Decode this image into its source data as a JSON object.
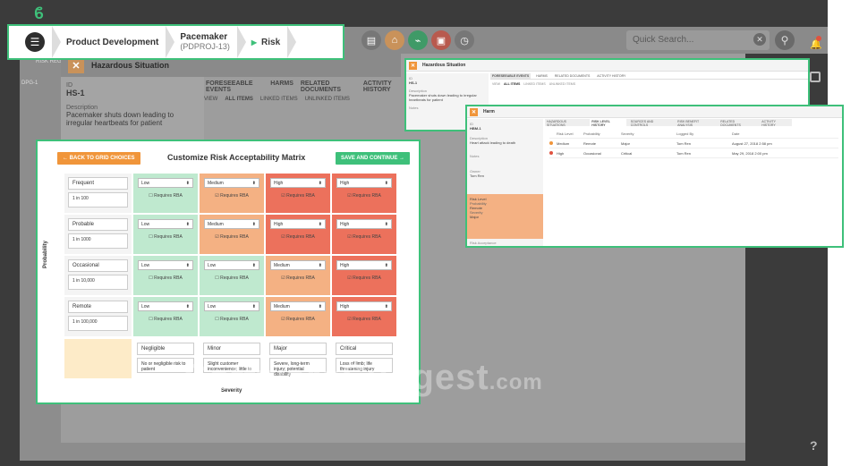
{
  "breadcrumb": {
    "items": [
      {
        "label": "Product Development",
        "sub": ""
      },
      {
        "label": "Pacemaker",
        "sub": "(PDPROJ-13)"
      },
      {
        "label": "Risk",
        "sub": ""
      }
    ]
  },
  "toolbar": {
    "search_placeholder": "Quick Search..."
  },
  "hazard_panel": {
    "title": "Hazardous Situation",
    "id_label": "ID",
    "id_value": "HS-1",
    "description_label": "Description",
    "description_value": "Pacemaker shuts down leading to irregular heartbeats for patient",
    "tabs": [
      "FORESEEABLE EVENTS",
      "HARMS",
      "RELATED DOCUMENTS",
      "ACTIVITY HISTORY"
    ],
    "subtabs": [
      "VIEW",
      "ALL ITEMS",
      "LINKED ITEMS",
      "UNLINKED ITEMS"
    ]
  },
  "matrix": {
    "back_label": "← BACK TO GRID CHOICES",
    "title": "Customize Risk Acceptability Matrix",
    "save_label": "SAVE AND CONTINUE →",
    "axis_y": "Probability",
    "axis_x": "Severity",
    "rows": [
      {
        "name": "Frequent",
        "desc": "1 in 100",
        "cells": [
          [
            "Low",
            "Requires RBA",
            "low"
          ],
          [
            "Medium",
            "Requires RBA",
            "med"
          ],
          [
            "High",
            "Requires RBA",
            "high"
          ],
          [
            "High",
            "Requires RBA",
            "high"
          ]
        ]
      },
      {
        "name": "Probable",
        "desc": "1 in 1000",
        "cells": [
          [
            "Low",
            "Requires RBA",
            "low"
          ],
          [
            "Medium",
            "Requires RBA",
            "med"
          ],
          [
            "High",
            "Requires RBA",
            "high"
          ],
          [
            "High",
            "Requires RBA",
            "high"
          ]
        ]
      },
      {
        "name": "Occasional",
        "desc": "1 in 10,000",
        "cells": [
          [
            "Low",
            "Requires RBA",
            "low"
          ],
          [
            "Low",
            "Requires RBA",
            "low"
          ],
          [
            "Medium",
            "Requires RBA",
            "med"
          ],
          [
            "High",
            "Requires RBA",
            "high"
          ]
        ]
      },
      {
        "name": "Remote",
        "desc": "1 in 100,000",
        "cells": [
          [
            "Low",
            "Requires RBA",
            "low"
          ],
          [
            "Low",
            "Requires RBA",
            "low"
          ],
          [
            "Medium",
            "Requires RBA",
            "med"
          ],
          [
            "High",
            "Requires RBA",
            "high"
          ]
        ]
      }
    ],
    "columns": [
      {
        "name": "Negligible",
        "desc": "No or negligible risk to patient"
      },
      {
        "name": "Minor",
        "desc": "Slight customer inconvenience; little to"
      },
      {
        "name": "Major",
        "desc": "Severe, long-term injury; potential disability"
      },
      {
        "name": "Critical",
        "desc": "Loss of limb; life threatening injury"
      }
    ]
  },
  "win1": {
    "title": "Hazardous Situation",
    "id_label": "ID",
    "id_value": "HS-1",
    "desc_label": "Description",
    "desc_value": "Pacemaker shuts down leading to irregular heartbeats for patient",
    "notes_label": "Notes",
    "tabs": [
      "FORESEEABLE EVENTS",
      "HARMS",
      "RELATED DOCUMENTS",
      "ACTIVITY HISTORY"
    ],
    "subtabs": [
      "VIEW",
      "ALL ITEMS",
      "LINKED ITEMS",
      "UNLINKED ITEMS"
    ]
  },
  "win2": {
    "title": "Harm",
    "id_label": "ID",
    "id_value": "HBM-1",
    "desc_label": "Description",
    "desc_value": "Heart attack leading to death",
    "notes_label": "Notes",
    "owner_label": "Owner",
    "owner_value": "Tom Ren",
    "risk_level_label": "Risk Level",
    "probability_label": "Probability",
    "probability_value": "Remote",
    "severity_label": "Severity",
    "severity_value": "Major",
    "acceptance_label": "Risk Acceptance",
    "tabs": [
      "HAZARDOUS SITUATIONS",
      "RISK LEVEL HISTORY",
      "SOURCES AND CONTROLS",
      "RISK BENEFIT ANALYSIS",
      "RELATED DOCUMENTS",
      "ACTIVITY HISTORY"
    ],
    "table_headers": [
      "",
      "Risk Level",
      "Probability",
      "Severity",
      "Logged By",
      "Date"
    ],
    "table_rows": [
      {
        "color": "#f0953a",
        "level": "Medium",
        "probability": "Remote",
        "severity": "Major",
        "logged_by": "Tom Ren",
        "date": "August 27, 2018 2:58 pm"
      },
      {
        "color": "#e0523f",
        "level": "High",
        "probability": "Occasional",
        "severity": "Critical",
        "logged_by": "Tom Ren",
        "date": "May 29, 2018 2:00 pm"
      }
    ]
  },
  "watermark": {
    "main": "SoftwareSuggest",
    "suffix": ".com"
  },
  "help_label": "?",
  "side_labels": [
    "DPG-1",
    "RISK REGISTER"
  ]
}
